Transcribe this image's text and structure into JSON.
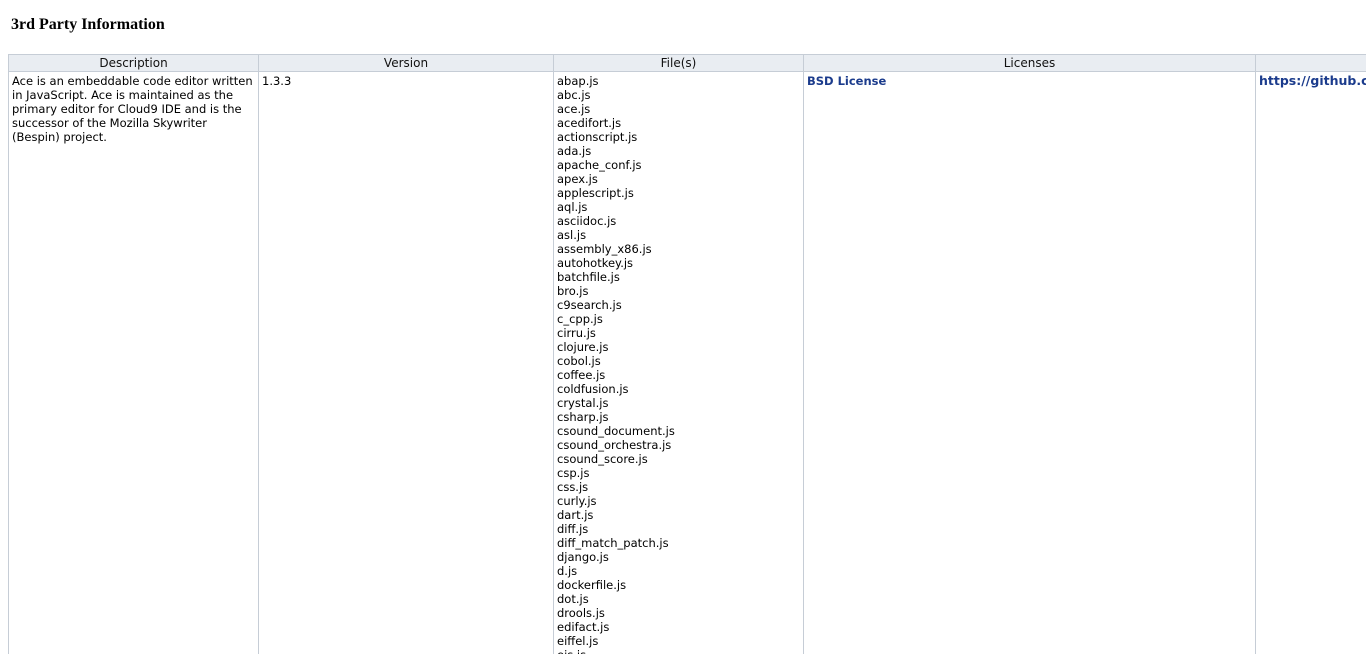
{
  "page": {
    "title": "3rd Party Information"
  },
  "table": {
    "headers": {
      "description": "Description",
      "version": "Version",
      "files": "File(s)",
      "licenses": "Licenses",
      "url": ""
    },
    "row": {
      "description": "Ace is an embeddable code editor written in JavaScript. Ace is maintained as the primary editor for Cloud9 IDE and is the successor of the Mozilla Skywriter (Bespin) project.",
      "version": "1.3.3",
      "files": [
        "abap.js",
        "abc.js",
        "ace.js",
        "acedifort.js",
        "actionscript.js",
        "ada.js",
        "apache_conf.js",
        "apex.js",
        "applescript.js",
        "aql.js",
        "asciidoc.js",
        "asl.js",
        "assembly_x86.js",
        "autohotkey.js",
        "batchfile.js",
        "bro.js",
        "c9search.js",
        "c_cpp.js",
        "cirru.js",
        "clojure.js",
        "cobol.js",
        "coffee.js",
        "coldfusion.js",
        "crystal.js",
        "csharp.js",
        "csound_document.js",
        "csound_orchestra.js",
        "csound_score.js",
        "csp.js",
        "css.js",
        "curly.js",
        "dart.js",
        "diff.js",
        "diff_match_patch.js",
        "django.js",
        "d.js",
        "dockerfile.js",
        "dot.js",
        "drools.js",
        "edifact.js",
        "eiffel.js",
        "ejs.js"
      ],
      "license": "BSD License",
      "url": "https://github.com/ajaxorg/ace"
    }
  }
}
